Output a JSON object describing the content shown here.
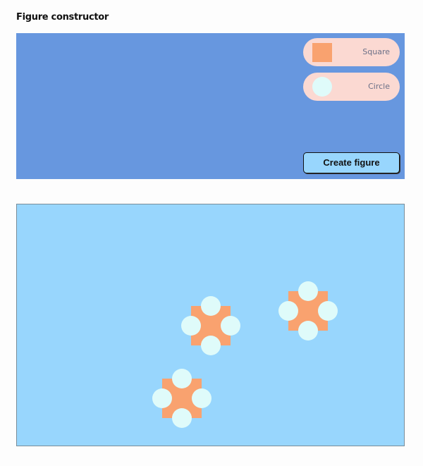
{
  "header": {
    "title": "Figure constructor"
  },
  "constructor": {
    "background_color": "#6797df",
    "options": [
      {
        "shape": "square",
        "label": "Square",
        "color": "#f9a26f"
      },
      {
        "shape": "circle",
        "label": "Circle",
        "color": "#dffbfa"
      }
    ],
    "create_button_label": "Create figure"
  },
  "canvas": {
    "background_color": "#98d6fd",
    "figure_count": 3,
    "figure_description": "square with four circles"
  }
}
